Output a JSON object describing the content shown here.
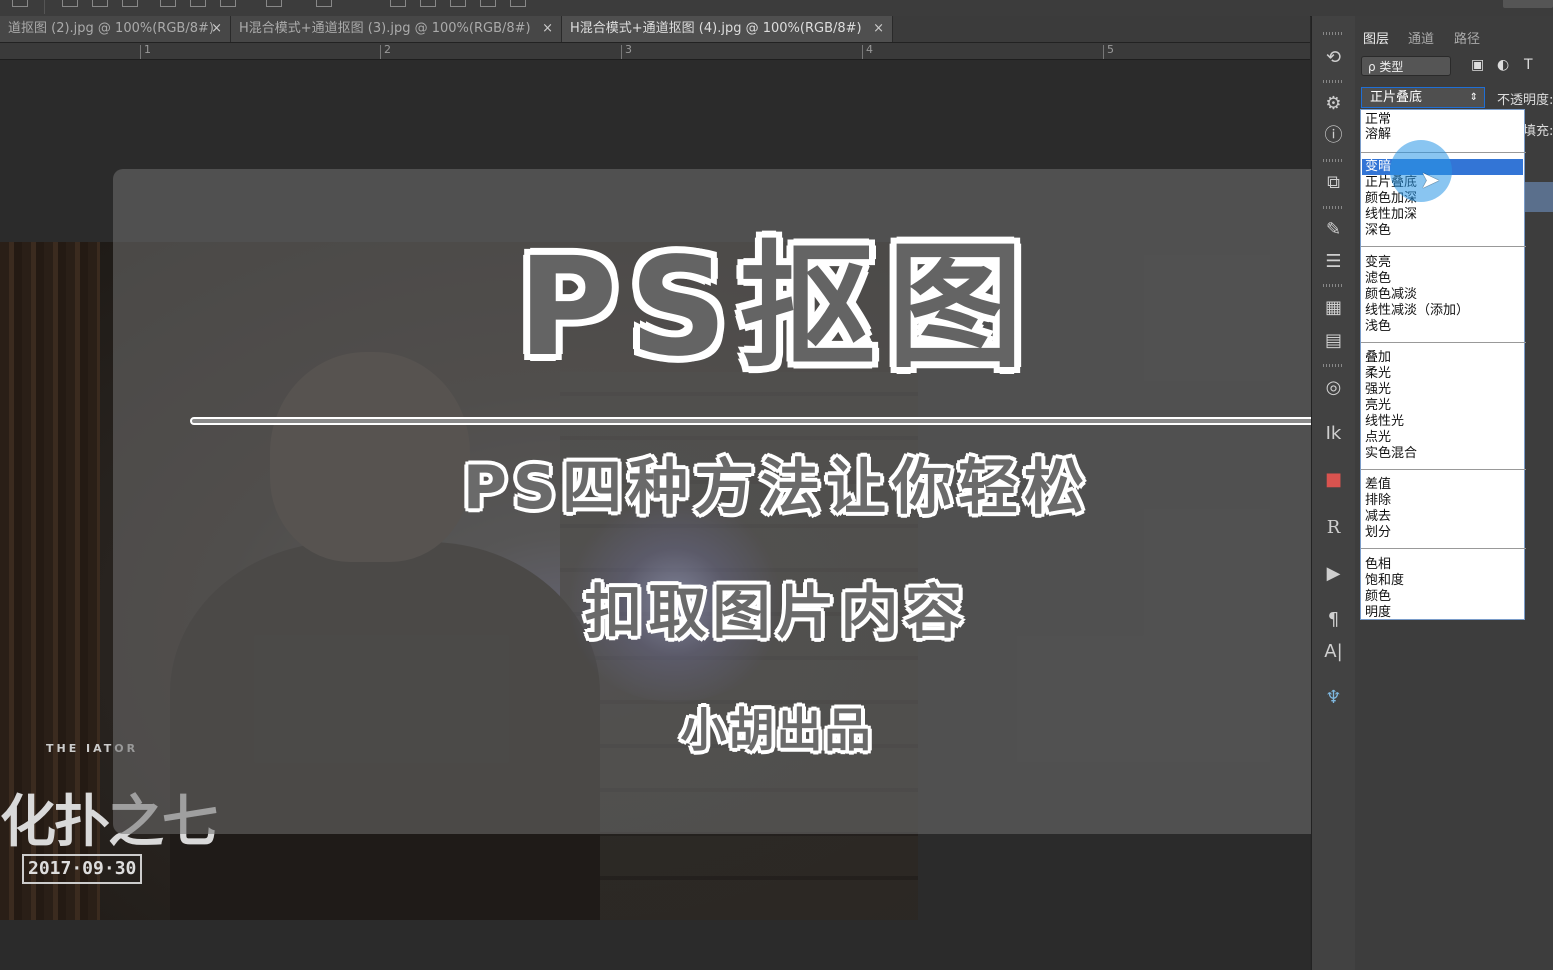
{
  "tabs": [
    {
      "label": "道抠图 (2).jpg @ 100%(RGB/8#)",
      "close": "×"
    },
    {
      "label": "H混合模式+通道抠图 (3).jpg @ 100%(RGB/8#)",
      "close": "×"
    },
    {
      "label": "H混合模式+通道抠图 (4).jpg @ 100%(RGB/8#)",
      "close": "×"
    }
  ],
  "ruler": [
    "1",
    "2",
    "3",
    "4",
    "5"
  ],
  "overlay": {
    "title": "PS抠图",
    "line1": "PS四种方法让你轻松",
    "line2": "扣取图片内容",
    "line3": "小胡出品"
  },
  "poster": {
    "small_text": "THE    IATOR",
    "title": "化扑之七",
    "date": "2017·09·30"
  },
  "panel": {
    "tabs": [
      "图层",
      "通道",
      "路径"
    ],
    "filter_label": "ρ 类型",
    "blend_mode": "正片叠底",
    "opacity_label": "不透明度:",
    "fill_label": "填充:"
  },
  "blend_modes": {
    "group1": [
      "正常",
      "溶解"
    ],
    "group2": [
      "变暗",
      "正片叠底",
      "颜色加深",
      "线性加深",
      "深色"
    ],
    "group3": [
      "变亮",
      "滤色",
      "颜色减淡",
      "线性减淡（添加）",
      "浅色"
    ],
    "group4": [
      "叠加",
      "柔光",
      "强光",
      "亮光",
      "线性光",
      "点光",
      "实色混合"
    ],
    "group5": [
      "差值",
      "排除",
      "减去",
      "划分"
    ],
    "group6": [
      "色相",
      "饱和度",
      "颜色",
      "明度"
    ],
    "highlighted": "变暗"
  },
  "colors": {
    "app_bg": "#282828",
    "panel_bg": "#3d3d3d",
    "highlight": "#3375d6",
    "cursor_ring": "#2896e6"
  }
}
